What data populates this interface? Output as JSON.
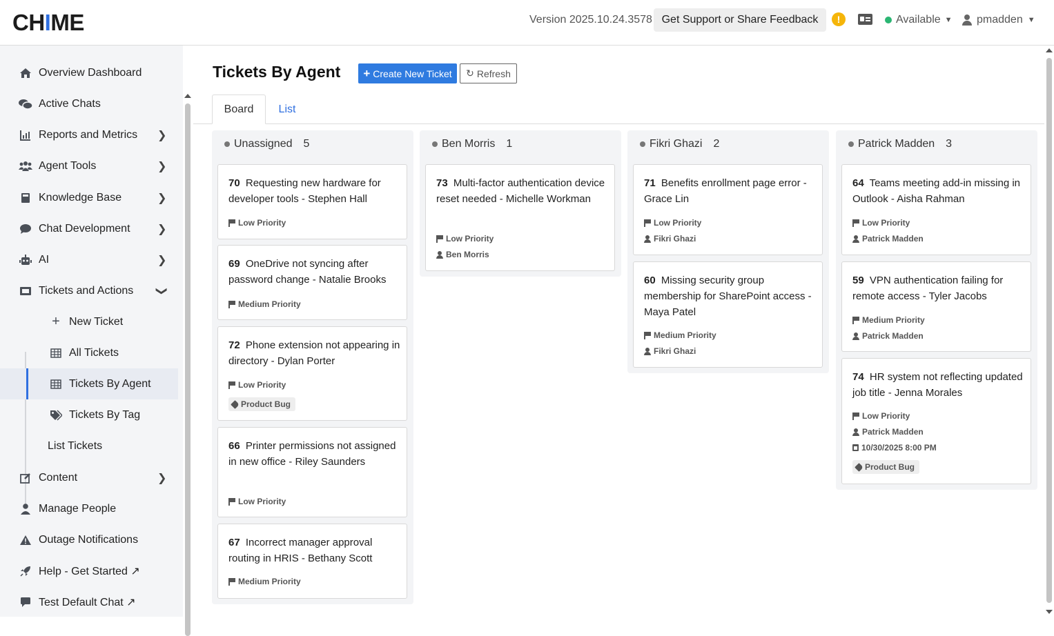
{
  "header": {
    "logo": {
      "pre": "CH",
      "accent": "I",
      "post": "ME"
    },
    "version": "Version 2025.10.24.3578",
    "support_label": "Get Support or Share Feedback",
    "warning_glyph": "!",
    "status_label": "Available",
    "username": "pmadden"
  },
  "sidebar": {
    "items": [
      {
        "label": "Overview Dashboard",
        "icon": "home-icon"
      },
      {
        "label": "Active Chats",
        "icon": "chats-icon"
      },
      {
        "label": "Reports and Metrics",
        "icon": "chart-icon"
      },
      {
        "label": "Agent Tools",
        "icon": "users-icon"
      },
      {
        "label": "Knowledge Base",
        "icon": "book-icon"
      },
      {
        "label": "Chat Development",
        "icon": "comment-icon"
      },
      {
        "label": "AI",
        "icon": "robot-icon"
      },
      {
        "label": "Tickets and Actions",
        "icon": "ticket-icon"
      },
      {
        "label": "New Ticket",
        "icon": "plus-icon"
      },
      {
        "label": "All Tickets",
        "icon": "table-icon"
      },
      {
        "label": "Tickets By Agent",
        "icon": "table-icon"
      },
      {
        "label": "Tickets By Tag",
        "icon": "tags-icon"
      },
      {
        "label": "List Tickets"
      },
      {
        "label": "Content",
        "icon": "edit-icon"
      },
      {
        "label": "Manage People",
        "icon": "user-icon"
      },
      {
        "label": "Outage Notifications",
        "icon": "warning-icon"
      },
      {
        "label": "Help - Get Started ↗",
        "icon": "rocket-icon"
      },
      {
        "label": "Test Default Chat ↗",
        "icon": "message-icon"
      }
    ]
  },
  "main": {
    "title": "Tickets By Agent",
    "create_label": "Create New Ticket",
    "refresh_label": "Refresh",
    "tabs": [
      "Board",
      "List"
    ],
    "active_tab": "Board"
  },
  "columns": [
    {
      "name": "Unassigned",
      "count": "5",
      "tickets": [
        {
          "id": "70",
          "title": "Requesting new hardware for developer tools - Stephen Hall",
          "priority": "Low Priority"
        },
        {
          "id": "69",
          "title": "OneDrive not syncing after password change - Natalie Brooks",
          "priority": "Medium Priority"
        },
        {
          "id": "72",
          "title": "Phone extension not appearing in directory - Dylan Porter",
          "priority": "Low Priority",
          "tag": "Product Bug"
        },
        {
          "id": "66",
          "title": "Printer permissions not assigned in new office - Riley Saunders",
          "priority": "Low Priority"
        },
        {
          "id": "67",
          "title": "Incorrect manager approval routing in HRIS - Bethany Scott",
          "priority": "Medium Priority"
        }
      ]
    },
    {
      "name": "Ben Morris",
      "count": "1",
      "tickets": [
        {
          "id": "73",
          "title": "Multi-factor authentication device reset needed - Michelle Workman",
          "priority": "Low Priority",
          "agent": "Ben Morris"
        }
      ]
    },
    {
      "name": "Fikri Ghazi",
      "count": "2",
      "tickets": [
        {
          "id": "71",
          "title": "Benefits enrollment page error - Grace Lin",
          "priority": "Low Priority",
          "agent": "Fikri Ghazi"
        },
        {
          "id": "60",
          "title": "Missing security group membership for SharePoint access - Maya Patel",
          "priority": "Medium Priority",
          "agent": "Fikri Ghazi"
        }
      ]
    },
    {
      "name": "Patrick Madden",
      "count": "3",
      "tickets": [
        {
          "id": "64",
          "title": "Teams meeting add-in missing in Outlook - Aisha Rahman",
          "priority": "Low Priority",
          "agent": "Patrick Madden"
        },
        {
          "id": "59",
          "title": "VPN authentication failing for remote access - Tyler Jacobs",
          "priority": "Medium Priority",
          "agent": "Patrick Madden"
        },
        {
          "id": "74",
          "title": "HR system not reflecting updated job title - Jenna Morales",
          "priority": "Low Priority",
          "agent": "Patrick Madden",
          "due": "10/30/2025 8:00 PM",
          "tag": "Product Bug"
        }
      ]
    }
  ],
  "colors": {
    "accent": "#2f7be0",
    "status_available": "#2bb673",
    "warning": "#f5b50a"
  }
}
